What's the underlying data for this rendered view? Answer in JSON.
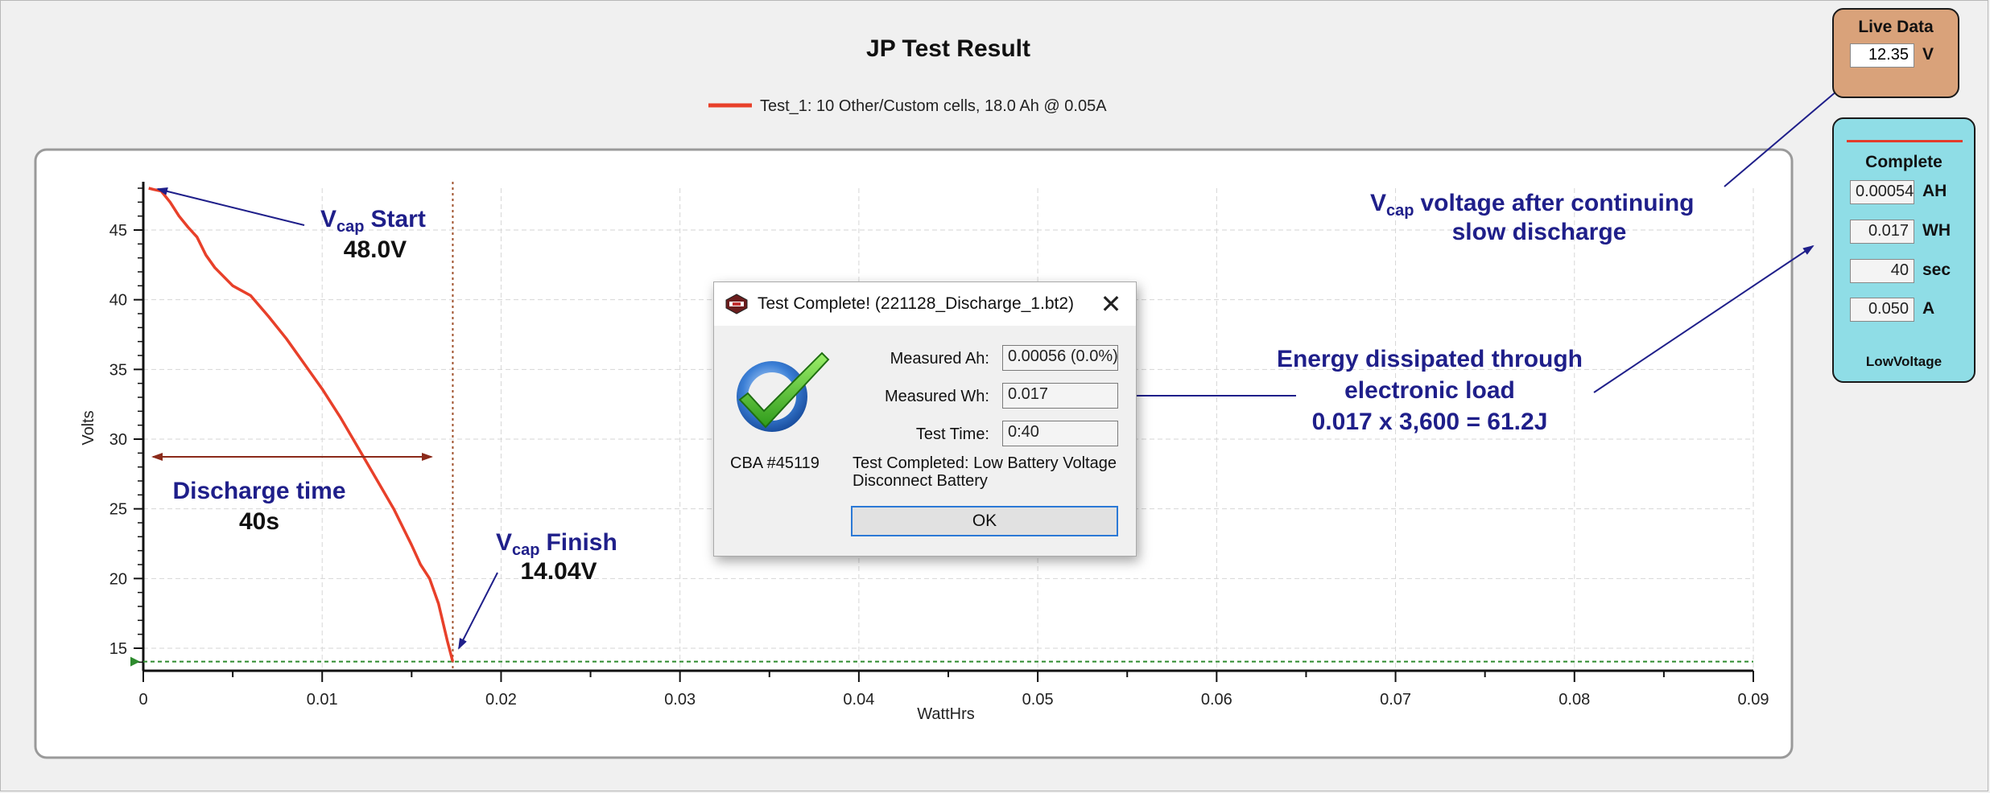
{
  "chart_data": {
    "type": "line",
    "title": "JP Test Result",
    "xlabel": "WattHrs",
    "ylabel": "Volts",
    "xlim": [
      0,
      0.09
    ],
    "ylim": [
      13.5,
      48
    ],
    "x_ticks": [
      "0",
      "0.01",
      "0.02",
      "0.03",
      "0.04",
      "0.05",
      "0.06",
      "0.07",
      "0.08",
      "0.09"
    ],
    "y_ticks": [
      "15",
      "20",
      "25",
      "30",
      "35",
      "40",
      "45"
    ],
    "grid": true,
    "legend_position": "top-center",
    "series": [
      {
        "name": "Test_1: 10 Other/Custom cells, 18.0 Ah @ 0.05A",
        "color": "#e8402a",
        "x": [
          0.0003,
          0.0006,
          0.001,
          0.0015,
          0.002,
          0.0025,
          0.003,
          0.0035,
          0.004,
          0.005,
          0.006,
          0.007,
          0.008,
          0.009,
          0.01,
          0.011,
          0.012,
          0.013,
          0.014,
          0.015,
          0.0155,
          0.016,
          0.0165,
          0.017,
          0.0173
        ],
        "y": [
          48.0,
          47.9,
          47.8,
          47.0,
          46.0,
          45.2,
          44.5,
          43.2,
          42.3,
          41.0,
          40.3,
          38.8,
          37.2,
          35.4,
          33.6,
          31.6,
          29.4,
          27.2,
          25.0,
          22.4,
          21.0,
          20.0,
          18.2,
          15.5,
          14.04
        ]
      }
    ],
    "reference_lines": {
      "vertical_x": 0.0173,
      "horizontal_y": 14.04
    },
    "annotations": {
      "vcap_word": "V",
      "vcap_sub": "cap",
      "start_label": "Start",
      "start_value": "48.0V",
      "finish_label": "Finish",
      "finish_value": "14.04V",
      "discharge_label": "Discharge time",
      "discharge_value": "40s",
      "live_note_line1": "voltage after continuing",
      "live_note_line2": "slow discharge",
      "energy_line1": "Energy dissipated through",
      "energy_line2": "electronic load",
      "energy_line3": "0.017 x 3,600 = 61.2J"
    }
  },
  "dialog": {
    "title": "Test Complete! (221128_Discharge_1.bt2)",
    "close_glyph": "✕",
    "cba_label": "CBA #45119",
    "measured_ah_label": "Measured Ah:",
    "measured_ah_value": "0.00056 (0.0%)",
    "measured_wh_label": "Measured Wh:",
    "measured_wh_value": "0.017",
    "test_time_label": "Test Time:",
    "test_time_value": "0:40",
    "status_line1": "Test Completed: Low Battery Voltage",
    "status_line2": "Disconnect Battery",
    "ok_label": "OK"
  },
  "live_data": {
    "title": "Live Data",
    "value": "12.35",
    "unit": "V"
  },
  "complete_panel": {
    "title": "Complete",
    "fields": [
      {
        "value": "0.00054",
        "unit": "AH"
      },
      {
        "value": "0.017",
        "unit": "WH"
      },
      {
        "value": "40",
        "unit": "sec"
      },
      {
        "value": "0.050",
        "unit": "A"
      }
    ],
    "status": "LowVoltage"
  },
  "colors": {
    "accent_red": "#e8402a",
    "annotation_blue": "#1f1f8a",
    "live_panel": "#d9a27a",
    "complete_panel": "#8fdde6"
  }
}
